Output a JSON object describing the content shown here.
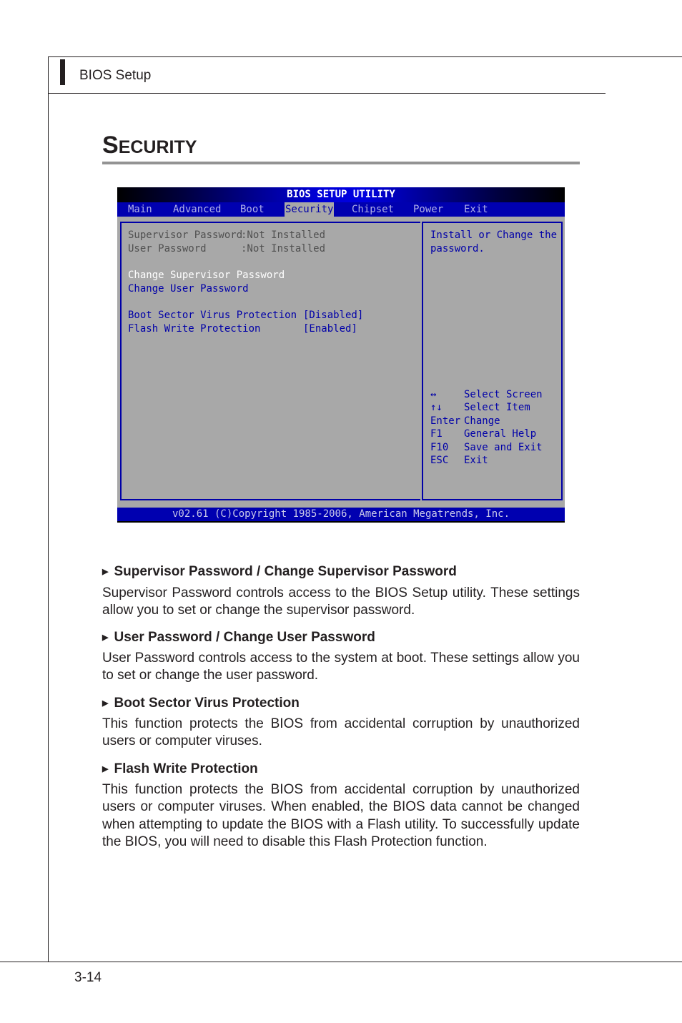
{
  "header": {
    "title": "BIOS Setup"
  },
  "section": {
    "title_first": "S",
    "title_rest": "ecurity"
  },
  "bios": {
    "title": "BIOS SETUP UTILITY",
    "menu": [
      {
        "label": "Main",
        "active": false
      },
      {
        "label": "Advanced",
        "active": false
      },
      {
        "label": "Boot",
        "active": false
      },
      {
        "label": "Security",
        "active": true
      },
      {
        "label": "Chipset",
        "active": false
      },
      {
        "label": "Power",
        "active": false
      },
      {
        "label": "Exit",
        "active": false
      }
    ],
    "status": [
      {
        "label": "Supervisor Password",
        "value": ":Not Installed"
      },
      {
        "label": "User Password",
        "value": ":Not Installed"
      }
    ],
    "actions": [
      {
        "label": "Change Supervisor Password",
        "selected": true
      },
      {
        "label": "Change User Password",
        "selected": false
      }
    ],
    "options": [
      {
        "label": "Boot Sector Virus Protection",
        "value": "[Disabled]"
      },
      {
        "label": "Flash Write Protection",
        "value": "[Enabled]"
      }
    ],
    "help_text": [
      "Install or Change the",
      "password."
    ],
    "keys": [
      {
        "key": "↔",
        "action": "Select Screen",
        "icon": "left-right-arrow-icon"
      },
      {
        "key": "↑↓",
        "action": "Select Item",
        "icon": "up-down-arrow-icon"
      },
      {
        "key": "Enter",
        "action": "Change"
      },
      {
        "key": "F1",
        "action": "General Help"
      },
      {
        "key": "F10",
        "action": "Save and Exit"
      },
      {
        "key": "ESC",
        "action": "Exit"
      }
    ],
    "footer": "v02.61 (C)Copyright 1985-2006, American Megatrends, Inc.",
    "colors": {
      "background": "#a8a8a8",
      "menu_bar": "#0000b0",
      "accent_blue": "#0000a8",
      "highlight": "#ffffff",
      "inactive_text": "#505050"
    }
  },
  "items": [
    {
      "heading": "Supervisor Password / Change Supervisor Password",
      "body": "Supervisor Password controls access to the BIOS Setup utility. These settings allow you to set or change the supervisor password."
    },
    {
      "heading": "User Password / Change User Password",
      "body": "User Password controls access to the system at boot. These settings allow you to set or change the user password."
    },
    {
      "heading": "Boot Sector Virus Protection",
      "body": "This function protects the BIOS from accidental corruption by unauthorized users or computer viruses."
    },
    {
      "heading": "Flash Write Protection",
      "body": "This function protects the BIOS from accidental corruption by unauthorized users or computer viruses. When enabled, the BIOS data cannot be changed when attempting to update the BIOS with a Flash utility. To successfully update the BIOS, you will need to disable this Flash Protection function."
    }
  ],
  "footer": {
    "page_number": "3-14"
  },
  "bullet_glyph": "▶"
}
